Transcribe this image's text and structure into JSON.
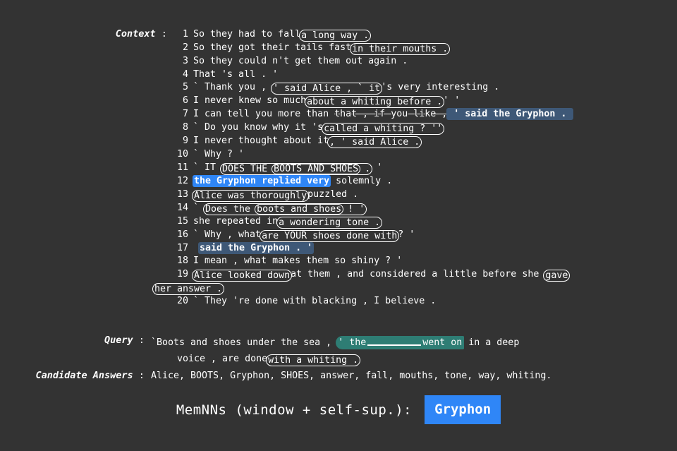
{
  "background_color": "#333333",
  "accent_blue": "#2f86f7",
  "accent_navy": "#3e5877",
  "accent_teal": "#2e7d74",
  "context": {
    "label": "Context",
    "colon": " : ",
    "lines": [
      {
        "n": "1",
        "pre": "So they had to fall",
        "post": ""
      },
      {
        "n": "2",
        "pre": "So they got their tails fast",
        "post": ""
      },
      {
        "n": "3",
        "text": "So they could n't get them out again ."
      },
      {
        "n": "4",
        "text": "That 's all . '"
      },
      {
        "n": "5",
        "pre": "` Thank you , ",
        "post": "'s very interesting ."
      },
      {
        "n": "6",
        "pre": "I never knew so much",
        "post": "' '"
      },
      {
        "n": "7",
        "pre": "I can tell you more than ",
        "post": ""
      },
      {
        "n": "8",
        "pre": "` Do you know why it 's",
        "post": ""
      },
      {
        "n": "9",
        "pre": "I never thought about it",
        "post": ""
      },
      {
        "n": "10",
        "text": "` Why ? '"
      },
      {
        "n": "11",
        "pre": "` IT ",
        "post": " '"
      },
      {
        "n": "12",
        "pre": "",
        "post": " solemnly ."
      },
      {
        "n": "13",
        "pre": "",
        "post": "puzzled ."
      },
      {
        "n": "14",
        "pre": "` ",
        "post": ""
      },
      {
        "n": "15",
        "pre": "she repeated in",
        "post": ""
      },
      {
        "n": "16",
        "pre": "` Why , what",
        "post": "? '"
      },
      {
        "n": "17",
        "pre": " ",
        "post": ""
      },
      {
        "n": "18",
        "text": "I mean , what makes them so shiny ? '"
      },
      {
        "n": "19",
        "pre": "",
        "post": "at them , and considered a little before she "
      },
      {
        "n": "20",
        "text": "` They 're done with blacking , I believe ."
      }
    ],
    "boxes": {
      "l1": "a long way .",
      "l2": "in their mouths .",
      "l5": "' said Alice , ` it",
      "l6": "about a whiting before .",
      "l7_underline": "that , if you like ,",
      "l7_hl": " ' said the Gryphon . ",
      "l8": "called a whiting ? ''",
      "l9": ", ' said Alice .",
      "l11_outer_a": "DOES THE ",
      "l11_inner": "BOOTS AND SHOES",
      "l11_outer_b": " .",
      "l12_hl": "the Gryphon replied very",
      "l13": "Alice was thoroughly",
      "l14_outer_a": "Does the ",
      "l14_inner": "boots and shoes",
      "l14_outer_b": " ! '",
      "l15": "a wondering tone .",
      "l16": "are YOUR shoes done with",
      "l17_hl": "said the Gryphon . '",
      "l19_a": "Alice looked down",
      "l19_b": "gave",
      "l19_wrap": "her answer ."
    }
  },
  "query": {
    "label": "Query",
    "colon": " : ",
    "line1_pre": "`Boots and shoes under the sea , ",
    "highlight_pre": "' the",
    "highlight_post": "went on",
    "line1_post": " in a deep",
    "line2_pre": "voice , are done",
    "line2_box": "with a whiting ."
  },
  "candidates": {
    "label": "Candidate Answers",
    "colon": " : ",
    "list": "Alice, BOOTS, Gryphon, SHOES, answer, fall, mouths, tone, way, whiting."
  },
  "prediction": {
    "model_label": "MemNNs (window + self-sup.):",
    "answer": "Gryphon"
  }
}
